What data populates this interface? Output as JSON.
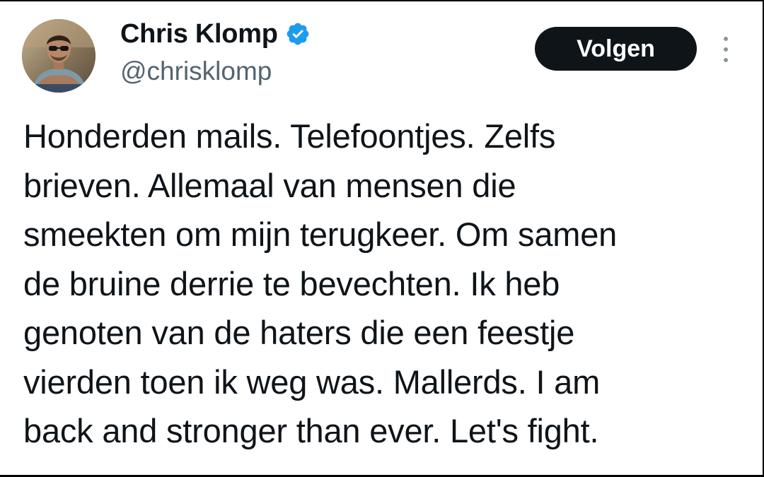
{
  "author": {
    "name": "Chris Klomp",
    "handle": "@chrisklomp",
    "verified": true,
    "verified_icon": "verified-badge-icon",
    "avatar_icon": "profile-photo"
  },
  "actions": {
    "follow_label": "Volgen",
    "more_icon": "vertical-ellipsis-icon"
  },
  "tweet": {
    "lines": [
      "Honderden mails. Telefoontjes. Zelfs",
      "brieven. Allemaal van mensen die",
      "smeekten om mijn terugkeer. Om samen",
      "de bruine derrie te bevechten. Ik heb",
      "genoten van de haters die een feestje",
      "vierden toen ik weg was. Mallerds. I am",
      "back and stronger than ever. Let's fight."
    ]
  },
  "colors": {
    "text": "#0f1419",
    "secondary_text": "#536471",
    "follow_button_bg": "#0f1419",
    "verified_blue": "#1d9bf0"
  }
}
